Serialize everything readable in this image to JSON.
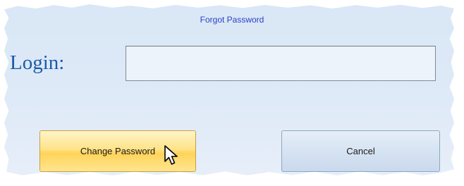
{
  "dialog": {
    "title": "Forgot Password"
  },
  "login": {
    "label": "Login:",
    "value": "",
    "placeholder": ""
  },
  "buttons": {
    "change_password": "Change Password",
    "cancel": "Cancel"
  },
  "colors": {
    "title": "#2a3fc7",
    "label": "#1d5aa8",
    "background": "#dde9f7",
    "change_button": "#ffe38a",
    "cancel_button": "#d6e3f2"
  },
  "icons": {
    "cursor": "arrow-cursor-icon"
  }
}
